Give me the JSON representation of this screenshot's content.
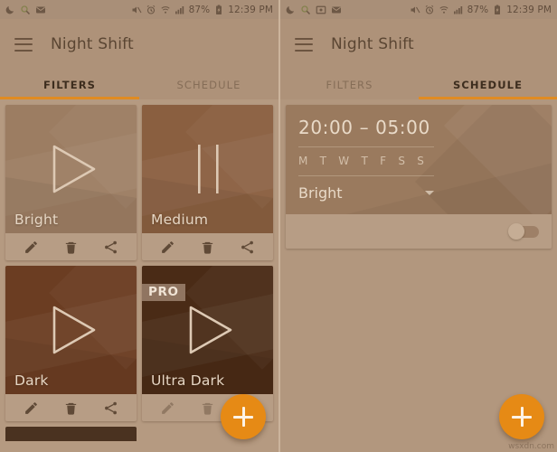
{
  "screens": [
    {
      "id": "filters-screen",
      "statusbar": {
        "left_icons": [
          "moon-icon",
          "search-icon",
          "envelope-icon"
        ],
        "right_icons": [
          "mute-icon",
          "alarm-icon",
          "wifi-icon",
          "signal-icon"
        ],
        "battery": "87%",
        "battery_icon": "battery-icon",
        "time": "12:39 PM"
      },
      "appbar": {
        "menu_icon": "hamburger-icon",
        "title": "Night Shift"
      },
      "tabs": {
        "items": [
          "FILTERS",
          "SCHEDULE"
        ],
        "active_index": 0
      },
      "fab": {
        "icon": "plus-icon",
        "label": "+",
        "color": "#e68a15"
      },
      "cards": [
        {
          "label": "Bright",
          "state_icon": "play-icon",
          "pro": false,
          "art_color": "#9c7d62",
          "actions": [
            {
              "name": "edit-icon",
              "enabled": true
            },
            {
              "name": "delete-icon",
              "enabled": true
            },
            {
              "name": "share-icon",
              "enabled": true
            }
          ]
        },
        {
          "label": "Medium",
          "state_icon": "pause-icon",
          "pro": false,
          "art_color": "#8a5f40",
          "actions": [
            {
              "name": "edit-icon",
              "enabled": true
            },
            {
              "name": "delete-icon",
              "enabled": true
            },
            {
              "name": "share-icon",
              "enabled": true
            }
          ]
        },
        {
          "label": "Dark",
          "state_icon": "play-icon",
          "pro": false,
          "art_color": "#6b3d22",
          "actions": [
            {
              "name": "edit-icon",
              "enabled": true
            },
            {
              "name": "delete-icon",
              "enabled": true
            },
            {
              "name": "share-icon",
              "enabled": true
            }
          ]
        },
        {
          "label": "Ultra Dark",
          "state_icon": "play-icon",
          "pro": true,
          "pro_badge": "PRO",
          "art_color": "#4a2b16",
          "actions": [
            {
              "name": "edit-icon",
              "enabled": false
            },
            {
              "name": "delete-icon",
              "enabled": false
            },
            {
              "name": "share-icon",
              "enabled": false
            }
          ]
        }
      ],
      "partial_card": {
        "art_color": "#4a3220"
      }
    },
    {
      "id": "schedule-screen",
      "statusbar": {
        "left_icons": [
          "moon-icon",
          "search-icon",
          "screenshot-icon",
          "envelope-icon"
        ],
        "right_icons": [
          "mute-icon",
          "alarm-icon",
          "wifi-icon",
          "signal-icon"
        ],
        "battery": "87%",
        "battery_icon": "battery-icon",
        "time": "12:39 PM"
      },
      "appbar": {
        "menu_icon": "hamburger-icon",
        "title": "Night Shift"
      },
      "tabs": {
        "items": [
          "FILTERS",
          "SCHEDULE"
        ],
        "active_index": 1
      },
      "fab": {
        "icon": "plus-icon",
        "label": "+",
        "color": "#e68a15"
      },
      "schedule": {
        "time_range": "20:00 – 05:00",
        "days": [
          "M",
          "T",
          "W",
          "T",
          "F",
          "S",
          "S"
        ],
        "filter_value": "Bright",
        "dropdown_icon": "chevron-down-icon",
        "enabled": false,
        "toggle_name": "schedule-toggle"
      }
    }
  ],
  "watermark": "wsxdn.com"
}
